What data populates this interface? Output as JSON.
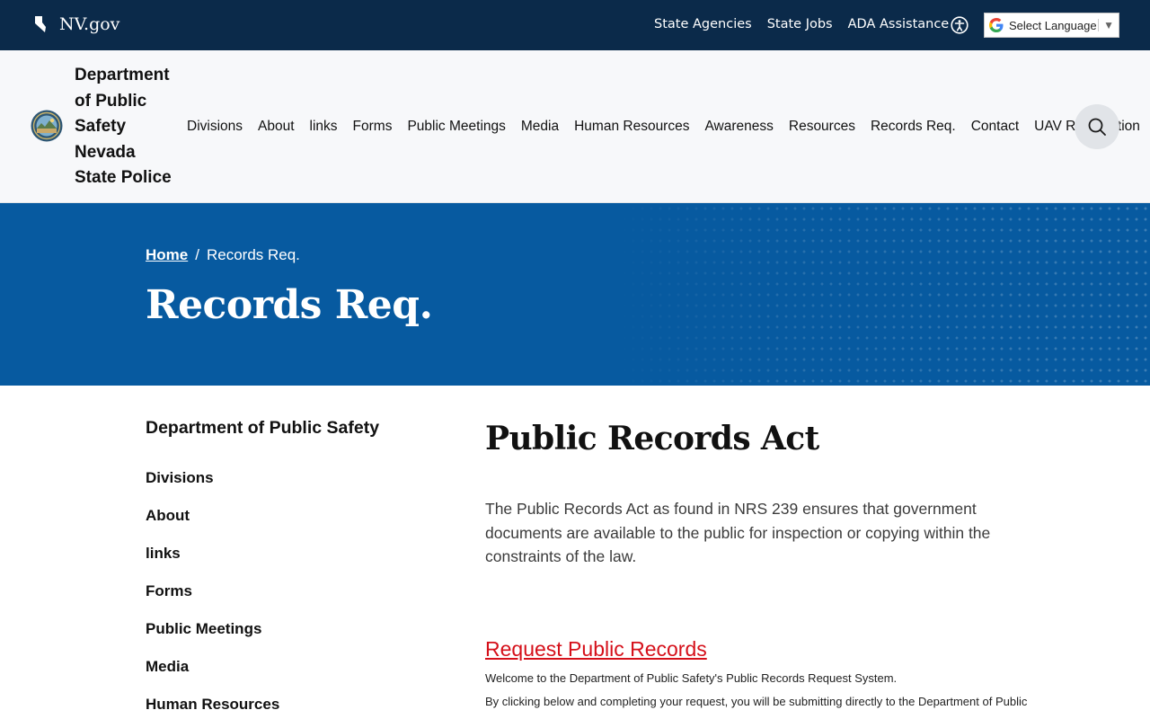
{
  "topbar": {
    "brand": "NV.gov",
    "links": [
      "State Agencies",
      "State Jobs",
      "ADA Assistance"
    ],
    "language_label": "Select Language"
  },
  "header": {
    "agency_lines": [
      "Department",
      "of Public",
      "Safety",
      "Nevada",
      "State Police"
    ],
    "nav": [
      "Divisions",
      "About",
      "links",
      "Forms",
      "Public Meetings",
      "Media",
      "Human Resources",
      "Awareness",
      "Resources",
      "Records Req.",
      "Contact",
      "UAV Registration"
    ]
  },
  "hero": {
    "breadcrumb_home": "Home",
    "breadcrumb_sep": "/",
    "breadcrumb_current": "Records Req.",
    "title": "Records Req."
  },
  "sidebar": {
    "title": "Department of Public Safety",
    "items": [
      "Divisions",
      "About",
      "links",
      "Forms",
      "Public Meetings",
      "Media",
      "Human Resources"
    ]
  },
  "content": {
    "heading": "Public Records Act",
    "lead": "The Public Records Act as found in NRS 239 ensures that government documents are available to the public for inspection or copying within the constraints of the law.",
    "request_link": "Request Public Records",
    "welcome": "Welcome to the Department of Public Safety's Public Records Request System.",
    "note": "By clicking below and completing your request, you will be submitting directly to the Department of Public"
  },
  "colors": {
    "topbar_bg": "#0b2a4a",
    "hero_bg": "#075aa0",
    "link_red": "#d5101a"
  },
  "icons": [
    "nevada-state-icon",
    "accessibility-icon",
    "google-icon",
    "state-seal-icon",
    "search-icon"
  ]
}
